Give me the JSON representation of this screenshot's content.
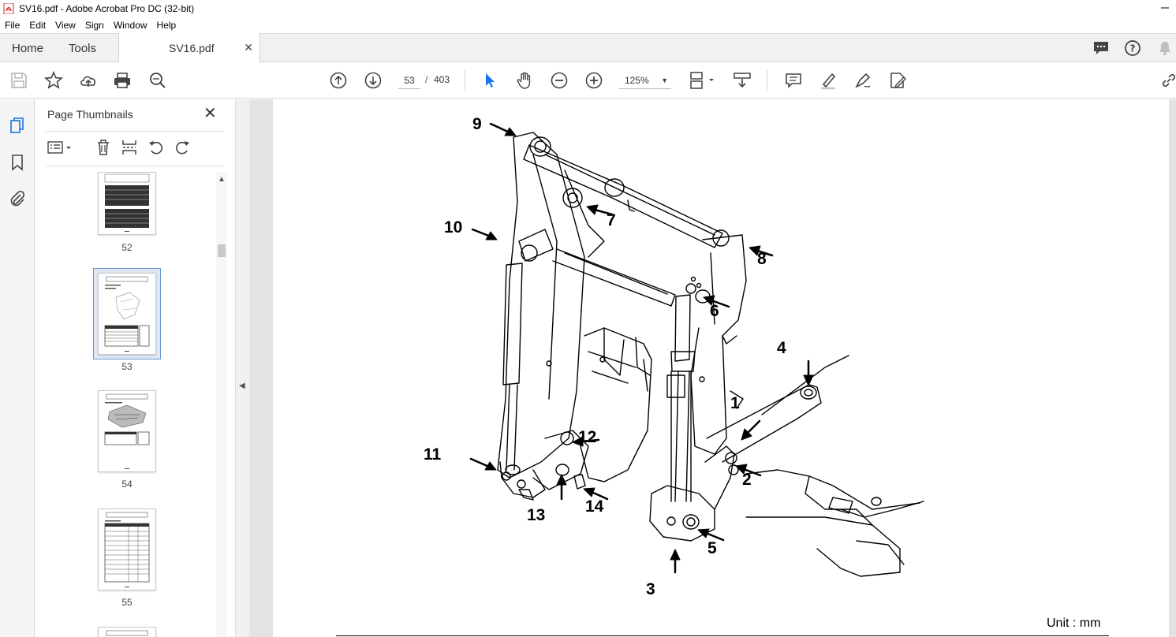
{
  "window": {
    "title": "SV16.pdf - Adobe Acrobat Pro DC (32-bit)"
  },
  "menu": [
    "File",
    "Edit",
    "View",
    "Sign",
    "Window",
    "Help"
  ],
  "tabs": {
    "home": "Home",
    "tools": "Tools",
    "document": "SV16.pdf"
  },
  "toolbar": {
    "current_page": "53",
    "page_separator": "/",
    "total_pages": "403",
    "zoom": "125%"
  },
  "thumbnails_panel": {
    "title": "Page Thumbnails",
    "pages": [
      {
        "label": "52",
        "selected": false
      },
      {
        "label": "53",
        "selected": true
      },
      {
        "label": "54",
        "selected": false
      },
      {
        "label": "55",
        "selected": false
      }
    ]
  },
  "document": {
    "unit_label": "Unit : mm",
    "callouts": [
      "1",
      "2",
      "3",
      "4",
      "5",
      "6",
      "7",
      "8",
      "9",
      "10",
      "11",
      "12",
      "13",
      "14"
    ]
  },
  "colors": {
    "accent": "#1473e6",
    "selection": "#dde8f5",
    "page_bg": "#e3e3e3"
  }
}
